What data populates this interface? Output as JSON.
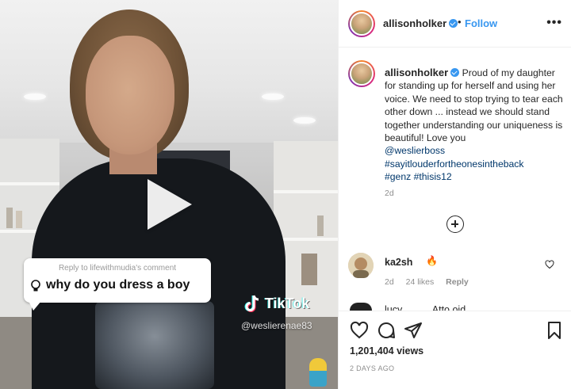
{
  "post": {
    "username": "allisonholker",
    "follow_label": "Follow",
    "separator": "•",
    "more_label": "•••",
    "caption": {
      "text_plain": "Proud of my daughter for standing up for herself and using her voice. We need to stop trying to tear each other down ... instead we should stand together understanding our uniqueness is beautiful! Love you",
      "mention": "@weslierboss",
      "hashtag_1": "#sayitlouderfortheonesintheback",
      "hashtag_2": "#genz",
      "hashtag_3": "#thisis12"
    },
    "caption_time": "2d",
    "views": "1,201,404 views",
    "posted": "2 DAYS AGO"
  },
  "video": {
    "reply_header": "Reply to lifewithmudia's comment",
    "reply_text": "why do you dress a boy",
    "tiktok_label": "TikTok",
    "tiktok_handle": "@weslierenae83"
  },
  "comments": [
    {
      "username": "ka2sh",
      "emoji": "🔥",
      "time": "2d",
      "likes": "24 likes",
      "reply_label": "Reply"
    },
    {
      "partial_text": "lucy_____ Atto oid"
    }
  ],
  "colors": {
    "accent": "#3897f0",
    "text": "#262626",
    "muted": "#8e8e8e",
    "link": "#00376b"
  },
  "icons": {
    "play": "play-icon",
    "like": "heart-icon",
    "comment": "comment-icon",
    "share": "paper-plane-icon",
    "save": "bookmark-icon",
    "load_more": "plus-circle-icon"
  }
}
